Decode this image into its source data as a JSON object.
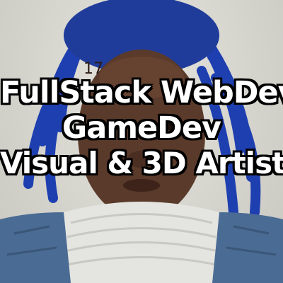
{
  "caption": {
    "line1": "FullStack WebDev",
    "line2": "GameDev",
    "line3": "Visual & 3D Artist"
  },
  "colors": {
    "text": "#ffffff",
    "outline": "#000000",
    "hair": "#1e3fb0",
    "background": "#d9d8d2",
    "sweater": "#e4e4e0",
    "jacket": "#4a6b93"
  }
}
